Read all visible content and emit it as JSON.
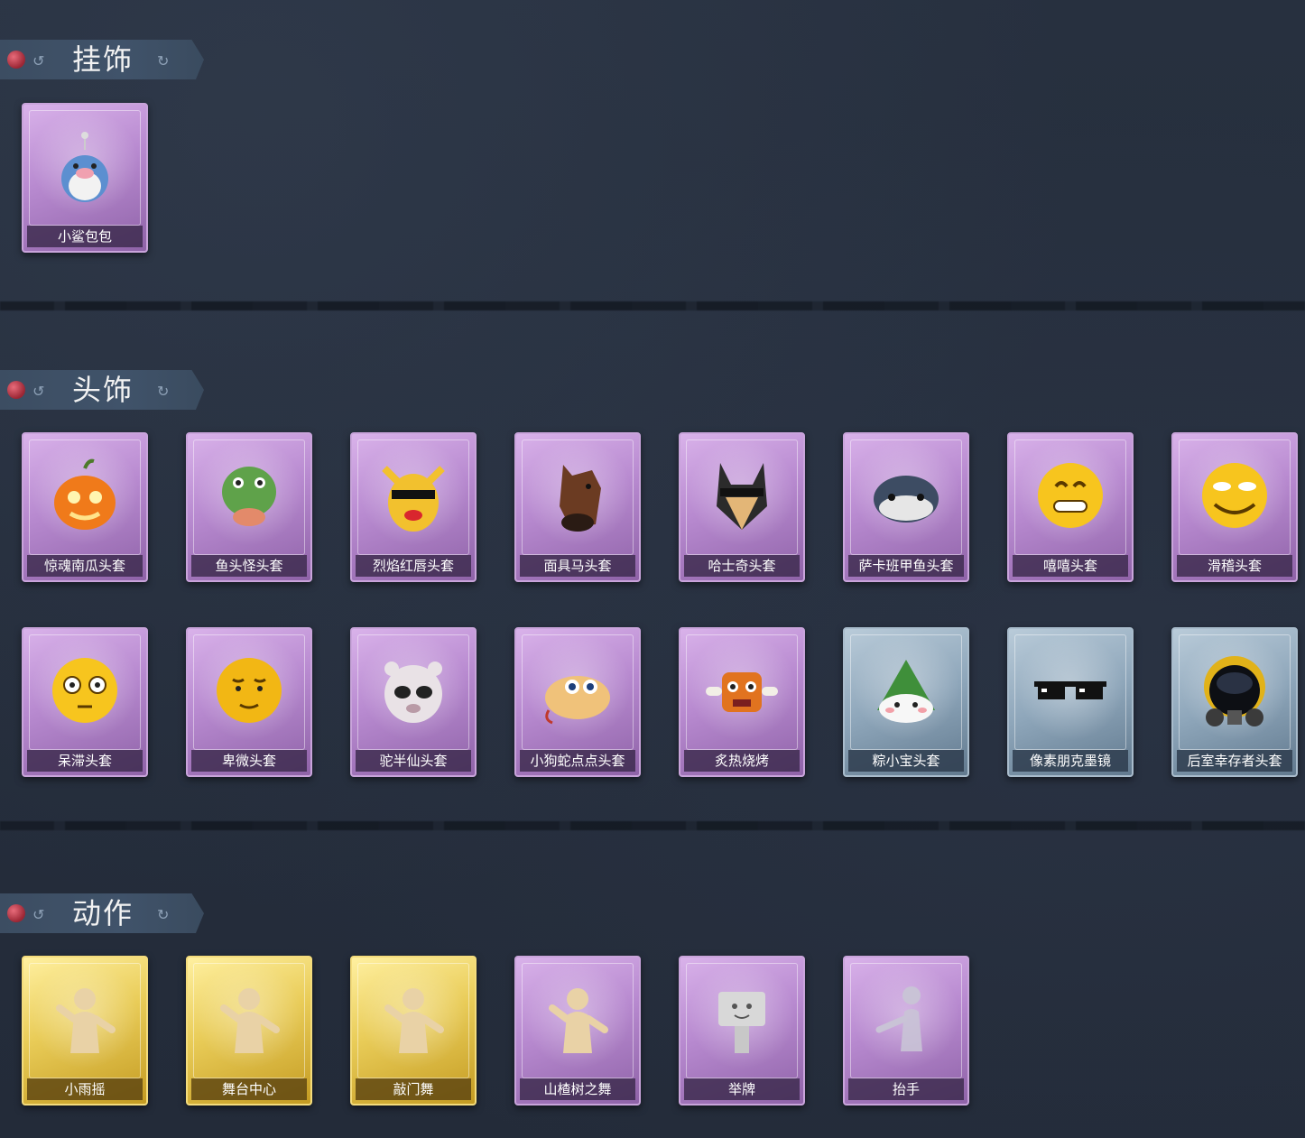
{
  "sections": {
    "pendants": {
      "title": "挂饰",
      "items": [
        {
          "name": "小鲨包包",
          "icon": "shark-bag-icon",
          "rarity": "purple"
        }
      ]
    },
    "headwear": {
      "title": "头饰",
      "items": [
        {
          "name": "惊魂南瓜头套",
          "icon": "pumpkin-head-icon",
          "rarity": "purple"
        },
        {
          "name": "鱼头怪头套",
          "icon": "fish-head-icon",
          "rarity": "purple"
        },
        {
          "name": "烈焰红唇头套",
          "icon": "yellow-mascot-head-icon",
          "rarity": "purple"
        },
        {
          "name": "面具马头套",
          "icon": "horse-head-icon",
          "rarity": "purple"
        },
        {
          "name": "哈士奇头套",
          "icon": "husky-head-icon",
          "rarity": "purple"
        },
        {
          "name": "萨卡班甲鱼头套",
          "icon": "sacabambaspis-head-icon",
          "rarity": "purple"
        },
        {
          "name": "嘻嘻头套",
          "icon": "grin-emoji-head-icon",
          "rarity": "purple"
        },
        {
          "name": "滑稽头套",
          "icon": "smirk-emoji-head-icon",
          "rarity": "purple"
        },
        {
          "name": "呆滞头套",
          "icon": "dazed-emoji-head-icon",
          "rarity": "purple"
        },
        {
          "name": "卑微头套",
          "icon": "humble-emoji-head-icon",
          "rarity": "purple"
        },
        {
          "name": "驼半仙头套",
          "icon": "alpaca-head-icon",
          "rarity": "purple"
        },
        {
          "name": "小狗蛇点点头套",
          "icon": "snake-head-icon",
          "rarity": "purple"
        },
        {
          "name": "炙热烧烤",
          "icon": "bbq-head-icon",
          "rarity": "purple"
        },
        {
          "name": "粽小宝头套",
          "icon": "zongzi-head-icon",
          "rarity": "blue"
        },
        {
          "name": "像素朋克墨镜",
          "icon": "pixel-sunglasses-icon",
          "rarity": "blue"
        },
        {
          "name": "后室幸存者头套",
          "icon": "gas-mask-helmet-icon",
          "rarity": "blue"
        }
      ]
    },
    "emotes": {
      "title": "动作",
      "items": [
        {
          "name": "小雨摇",
          "icon": "dance-figure-icon",
          "rarity": "gold"
        },
        {
          "name": "舞台中心",
          "icon": "dance-figure-icon",
          "rarity": "gold"
        },
        {
          "name": "敲门舞",
          "icon": "dance-figure-icon",
          "rarity": "gold"
        },
        {
          "name": "山楂树之舞",
          "icon": "dance-figure-icon",
          "rarity": "purple"
        },
        {
          "name": "举牌",
          "icon": "sign-figure-icon",
          "rarity": "purple"
        },
        {
          "name": "抬手",
          "icon": "raise-hand-figure-icon",
          "rarity": "purple"
        }
      ]
    }
  },
  "colors": {
    "background": "#262f3e",
    "purple": "#b88ad0",
    "blue": "#8ea6ba",
    "gold": "#e9cc58"
  }
}
